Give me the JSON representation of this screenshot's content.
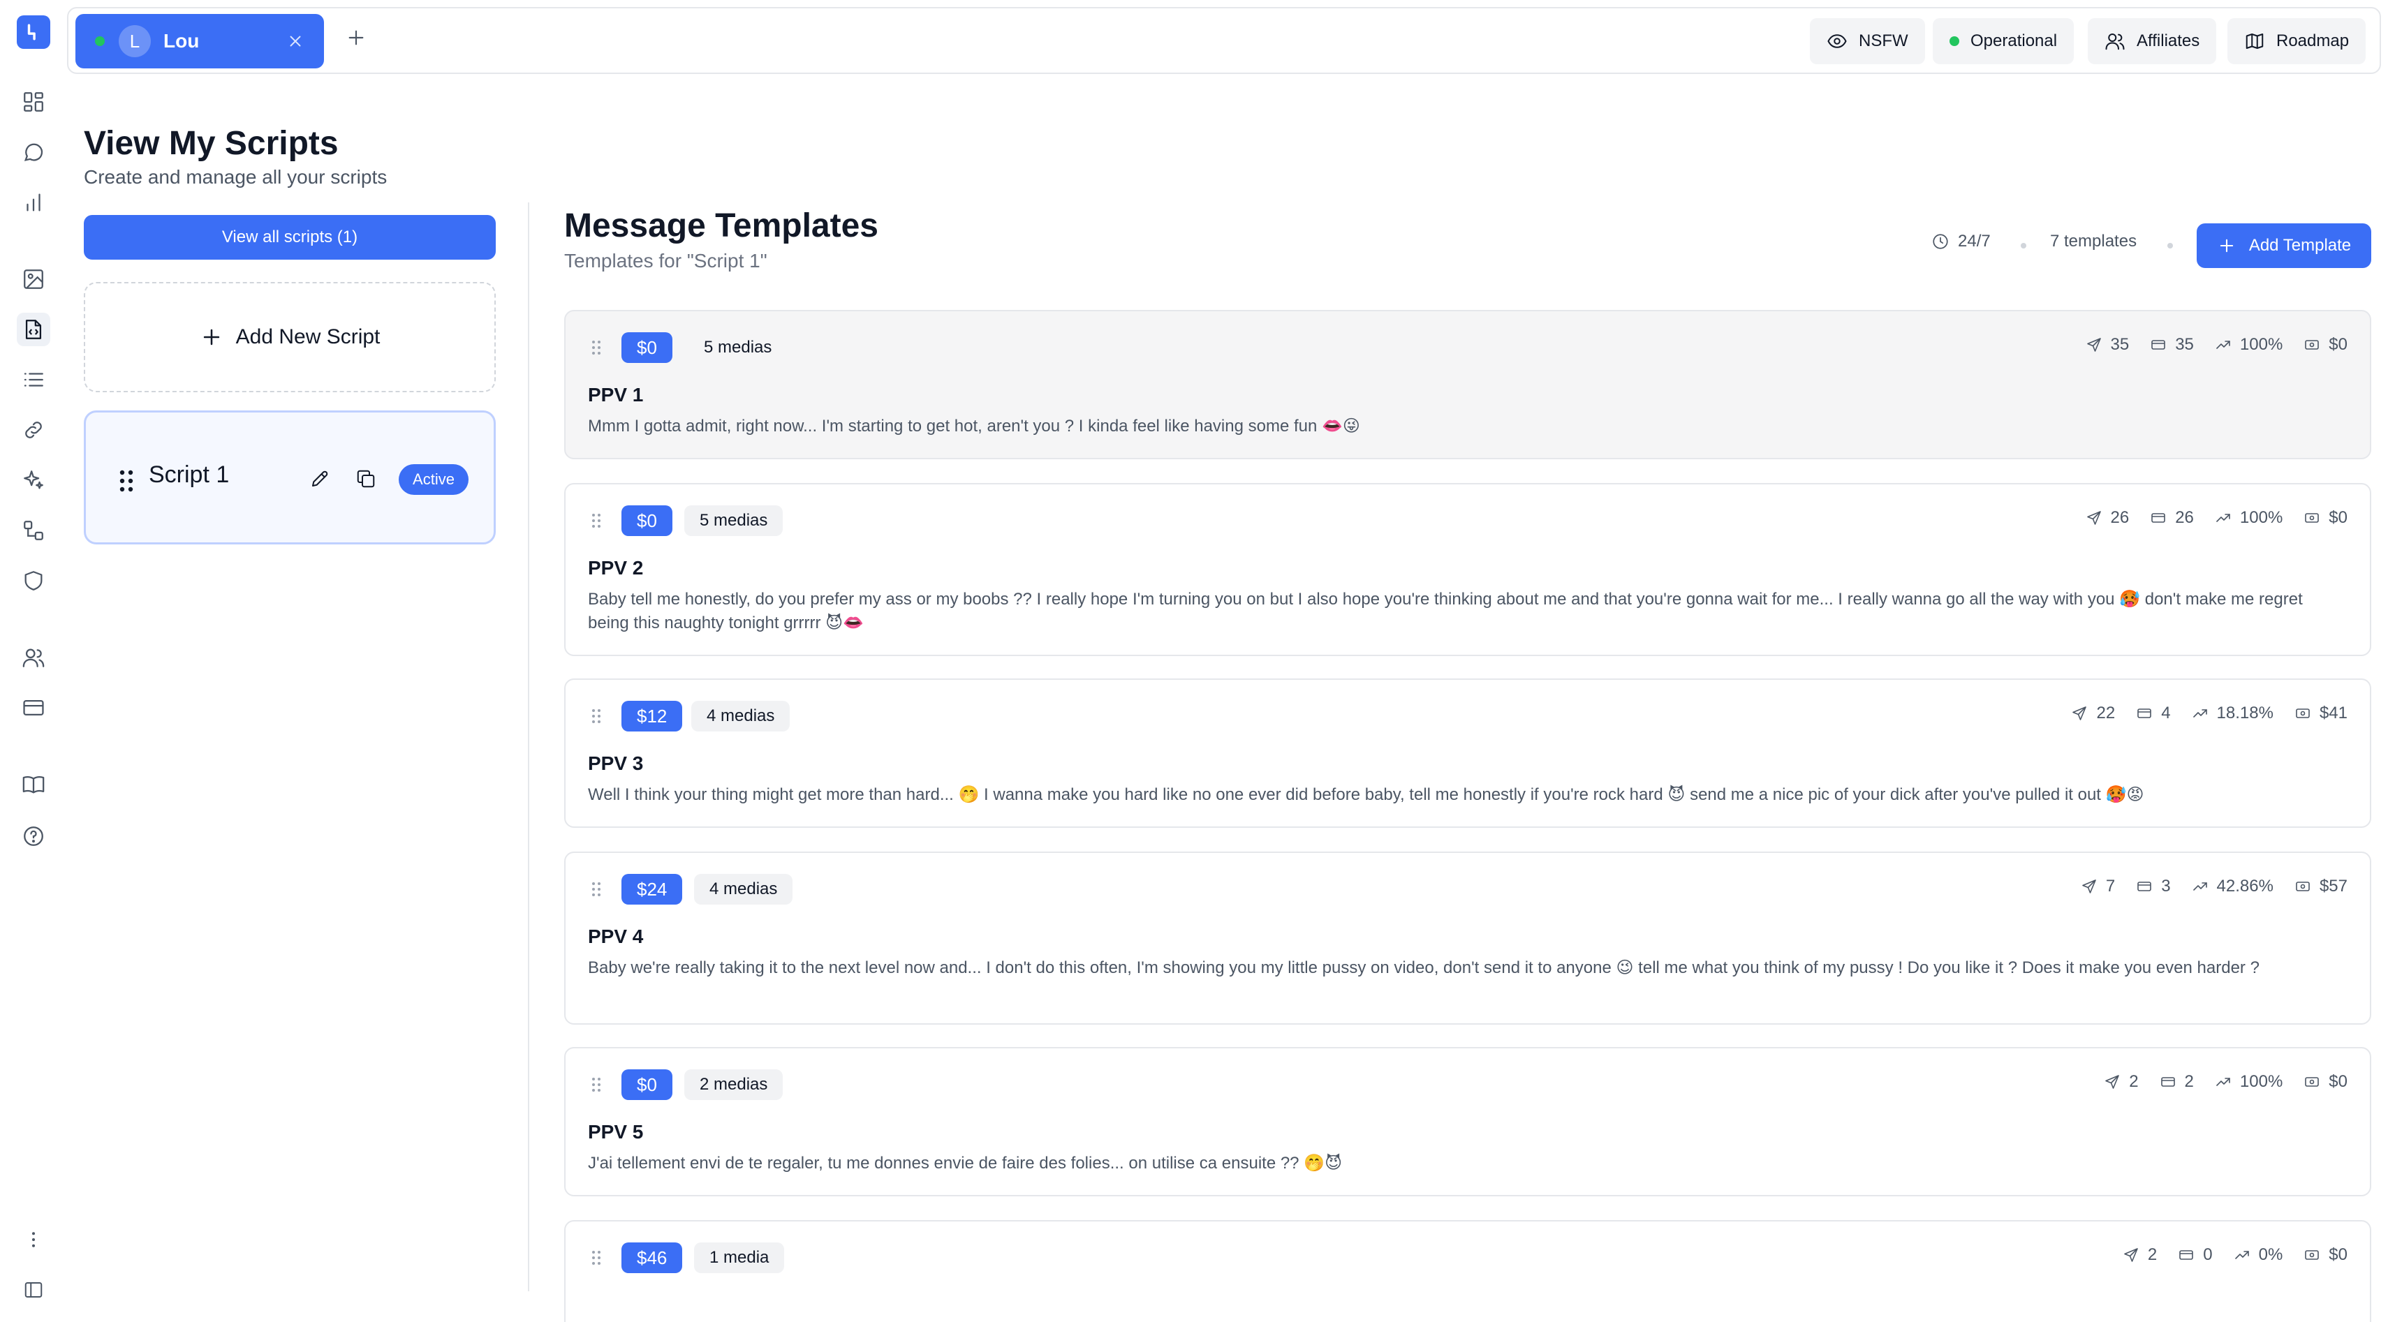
{
  "topbar": {
    "active_tab": {
      "initial": "L",
      "name": "Lou",
      "status_color": "#22c55e"
    },
    "buttons": {
      "nsfw": "NSFW",
      "operational": "Operational",
      "affiliates": "Affiliates",
      "roadmap": "Roadmap"
    }
  },
  "scripts": {
    "title": "View My Scripts",
    "subtitle": "Create and manage all your scripts",
    "view_all_label": "View all scripts (1)",
    "add_new_label": "Add New Script",
    "items": [
      {
        "name": "Script 1",
        "status": "Active"
      }
    ]
  },
  "templates": {
    "title": "Message Templates",
    "subtitle": "Templates for \"Script 1\"",
    "schedule": "24/7",
    "count_label": "7 templates",
    "add_label": "Add Template",
    "items": [
      {
        "price": "$0",
        "medias": "5 medias",
        "title": "PPV 1",
        "text": "Mmm I gotta admit, right now... I'm starting to get hot, aren't you ? I kinda feel like having some fun 👄😜",
        "sent": "35",
        "bought": "35",
        "rate": "100%",
        "revenue": "$0"
      },
      {
        "price": "$0",
        "medias": "5 medias",
        "title": "PPV 2",
        "text": "Baby tell me honestly, do you prefer my ass or my boobs ?? I really hope I'm turning you on but I also hope you're thinking about me and that you're gonna wait for me... I really wanna go all the way with you 🥵 don't make me regret being this naughty tonight grrrrr 😈👄",
        "sent": "26",
        "bought": "26",
        "rate": "100%",
        "revenue": "$0"
      },
      {
        "price": "$12",
        "medias": "4 medias",
        "title": "PPV 3",
        "text": "Well I think your thing might get more than hard... 🤭 I wanna make you hard like no one ever did before baby, tell me honestly if you're rock hard 😈 send me a nice pic of your dick after you've pulled it out 🥵😡",
        "sent": "22",
        "bought": "4",
        "rate": "18.18%",
        "revenue": "$41"
      },
      {
        "price": "$24",
        "medias": "4 medias",
        "title": "PPV 4",
        "text": "Baby we're really taking it to the next level now and... I don't do this often, I'm showing you my little pussy on video, don't send it to anyone 😉 tell me what you think of my pussy ! Do you like it ? Does it make you even harder ?",
        "sent": "7",
        "bought": "3",
        "rate": "42.86%",
        "revenue": "$57"
      },
      {
        "price": "$0",
        "medias": "2 medias",
        "title": "PPV 5",
        "text": "J'ai tellement envi de te regaler, tu me donnes envie de faire des folies... on utilise ca ensuite ?? 🤭😈",
        "sent": "2",
        "bought": "2",
        "rate": "100%",
        "revenue": "$0"
      },
      {
        "price": "$46",
        "medias": "1 media",
        "title": "",
        "text": "",
        "sent": "2",
        "bought": "0",
        "rate": "0%",
        "revenue": "$0"
      }
    ]
  },
  "colors": {
    "accent": "#3b6ef5",
    "status_green": "#22c55e"
  },
  "icons": {
    "rail": [
      "dashboard-icon",
      "chat-icon",
      "bar-chart-icon",
      "image-icon",
      "script-icon",
      "list-icon",
      "link-icon",
      "sparkles-icon",
      "workflow-icon",
      "shield-icon",
      "users-icon",
      "credit-card-icon",
      "book-icon",
      "help-icon",
      "more-vertical-icon",
      "sidebar-toggle-icon"
    ]
  }
}
